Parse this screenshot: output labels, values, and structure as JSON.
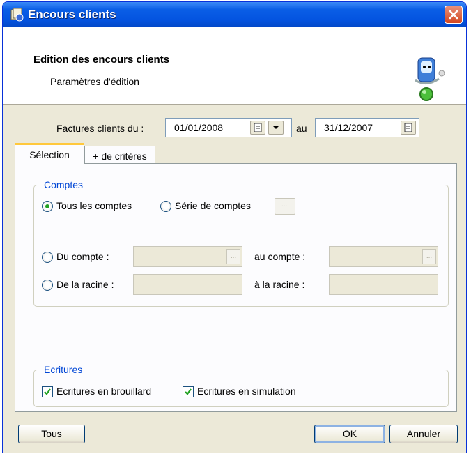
{
  "window": {
    "title": "Encours clients"
  },
  "header": {
    "title": "Edition des encours clients",
    "subtitle": "Paramètres d'édition"
  },
  "date_range": {
    "label": "Factures clients du :",
    "from": "01/01/2008",
    "separator": "au",
    "to": "31/12/2007"
  },
  "tabs": [
    {
      "label": "Sélection",
      "active": true
    },
    {
      "label": "+ de critères",
      "active": false
    }
  ],
  "comptes_group": {
    "title": "Comptes",
    "tous_label": "Tous les comptes",
    "serie_label": "Série de comptes",
    "serie_button": "...",
    "du_compte_label": "Du compte :",
    "au_compte_label": "au compte :",
    "de_racine_label": "De la racine :",
    "a_racine_label": "à la racine :",
    "ellipsis": "..."
  },
  "ecritures_group": {
    "title": "Ecritures",
    "brouillard_label": "Ecritures en brouillard",
    "simulation_label": "Ecritures en simulation"
  },
  "footer": {
    "tous": "Tous",
    "ok": "OK",
    "annuler": "Annuler"
  },
  "colors": {
    "titlebar": "#0a5ee6",
    "group_title": "#0046d5",
    "dialog_bg": "#ece9d8",
    "tab_accent": "#ffc83c",
    "check": "#21a121"
  }
}
